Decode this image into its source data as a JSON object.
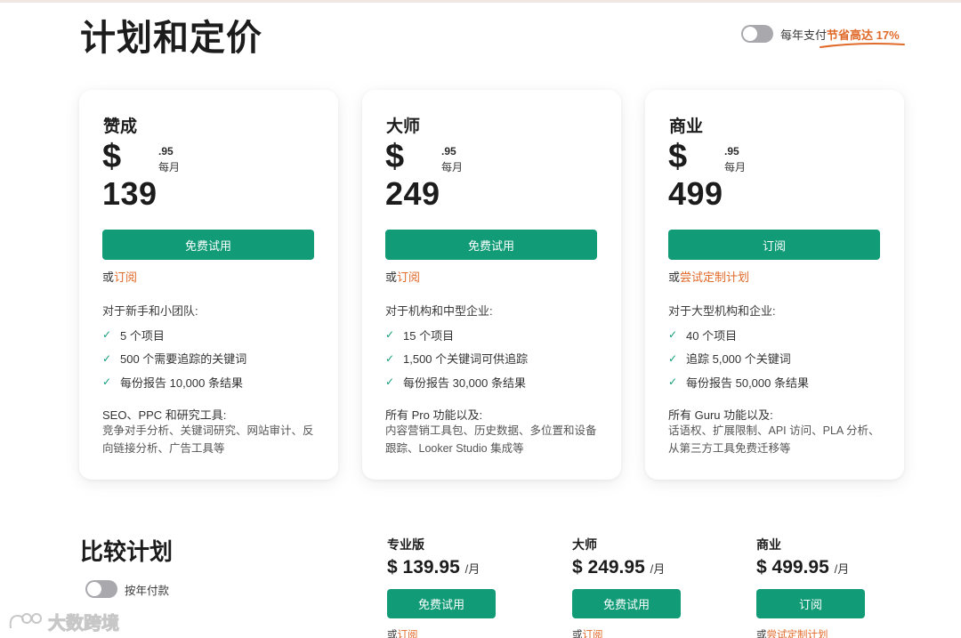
{
  "page": {
    "title": "计划和定价",
    "billing_toggle": {
      "label": "每年支付",
      "savings": "节省高达 17%",
      "on": false
    }
  },
  "plans": [
    {
      "name": "赞成",
      "currency": "$",
      "price": "139",
      "cents": ".95",
      "period": "每月",
      "cta": "免费试用",
      "alt_prefix": "或",
      "alt_link": "订阅",
      "for": "对于新手和小团队:",
      "features": [
        "5 个项目",
        "500 个需要追踪的关键词",
        "每份报告 10,000 条结果"
      ],
      "tools_title": "SEO、PPC 和研究工具:",
      "tools_desc": "竞争对手分析、关键词研究、网站审计、反向链接分析、广告工具等"
    },
    {
      "name": "大师",
      "currency": "$",
      "price": "249",
      "cents": ".95",
      "period": "每月",
      "cta": "免费试用",
      "alt_prefix": "或",
      "alt_link": "订阅",
      "for": "对于机构和中型企业:",
      "features": [
        "15 个项目",
        "1,500 个关键词可供追踪",
        "每份报告 30,000 条结果"
      ],
      "tools_title": "所有 Pro 功能以及:",
      "tools_desc": "内容营销工具包、历史数据、多位置和设备跟踪、Looker Studio 集成等"
    },
    {
      "name": "商业",
      "currency": "$",
      "price": "499",
      "cents": ".95",
      "period": "每月",
      "cta": "订阅",
      "alt_prefix": "或",
      "alt_link": "尝试定制计划",
      "for": "对于大型机构和企业:",
      "features": [
        "40 个项目",
        "追踪 5,000 个关键词",
        "每份报告 50,000 条结果"
      ],
      "tools_title": "所有 Guru 功能以及:",
      "tools_desc": "话语权、扩展限制、API 访问、PLA 分析、从第三方工具免费迁移等"
    }
  ],
  "compare": {
    "title": "比较计划",
    "toggle_label": "按年付款",
    "plans": [
      {
        "name": "专业版",
        "price": "$ 139.95",
        "per": "/月",
        "cta": "免费试用",
        "alt_prefix": "或",
        "alt_link": "订阅"
      },
      {
        "name": "大师",
        "price": "$ 249.95",
        "per": "/月",
        "cta": "免费试用",
        "alt_prefix": "或",
        "alt_link": "订阅"
      },
      {
        "name": "商业",
        "price": "$ 499.95",
        "per": "/月",
        "cta": "订阅",
        "alt_prefix": "或",
        "alt_link": "尝试定制计划"
      }
    ]
  },
  "watermark": {
    "text": "大数跨境"
  },
  "colors": {
    "accent": "#119b77",
    "link": "#e06a2a"
  }
}
